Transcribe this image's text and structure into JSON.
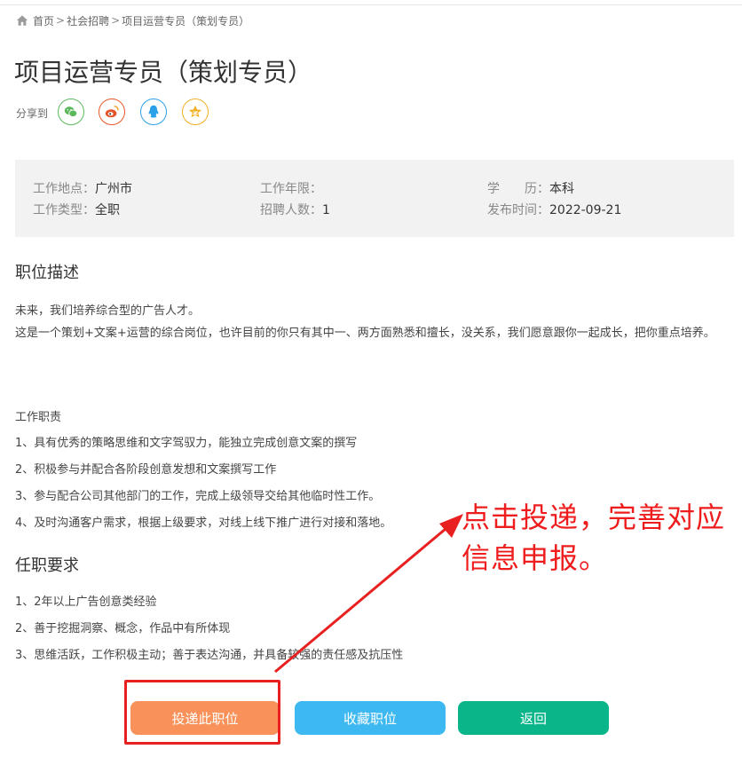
{
  "breadcrumb": {
    "home": "首页",
    "sep": ">",
    "recruit": "社会招聘",
    "current": "项目运营专员（策划专员）"
  },
  "title": "项目运营专员（策划专员）",
  "share": {
    "label": "分享到",
    "icons": [
      "wechat-icon",
      "weibo-icon",
      "qq-icon",
      "qzone-icon"
    ]
  },
  "info": {
    "location": {
      "label": "工作地点：",
      "value": "广州市"
    },
    "years": {
      "label": "工作年限：",
      "value": ""
    },
    "education": {
      "label": "学　　历：",
      "value": "本科"
    },
    "type": {
      "label": "工作类型：",
      "value": "全职"
    },
    "count": {
      "label": "招聘人数：",
      "value": "1"
    },
    "date": {
      "label": "发布时间：",
      "value": "2022-09-21"
    }
  },
  "description": {
    "heading": "职位描述",
    "intro1": "未来，我们培养综合型的广告人才。",
    "intro2": "这是一个策划+文案+运营的综合岗位，也许目前的你只有其中一、两方面熟悉和擅长，没关系，我们愿意跟你一起成长，把你重点培养。",
    "duties_heading": "工作职责",
    "duties": [
      "1、具有优秀的策略思维和文字驾驭力，能独立完成创意文案的撰写",
      "2、积极参与并配合各阶段创意发想和文案撰写工作",
      "3、参与配合公司其他部门的工作，完成上级领导交给其他临时性工作。",
      "4、及时沟通客户需求，根据上级要求，对线上线下推广进行对接和落地。"
    ]
  },
  "requirements": {
    "heading": "任职要求",
    "items": [
      "1、2年以上广告创意类经验",
      "2、善于挖掘洞察、概念，作品中有所体现",
      "3、思维活跃，工作积极主动；善于表达沟通，并具备较强的责任感及抗压性"
    ]
  },
  "buttons": {
    "apply": "投递此职位",
    "favorite": "收藏职位",
    "back": "返回"
  },
  "annotation": {
    "text": "点击投递，完善对应信息申报。"
  },
  "colors": {
    "apply": "#f9925a",
    "favorite": "#3eb8f0",
    "back": "#0ab58a",
    "annotation": "#ee1c1c"
  }
}
